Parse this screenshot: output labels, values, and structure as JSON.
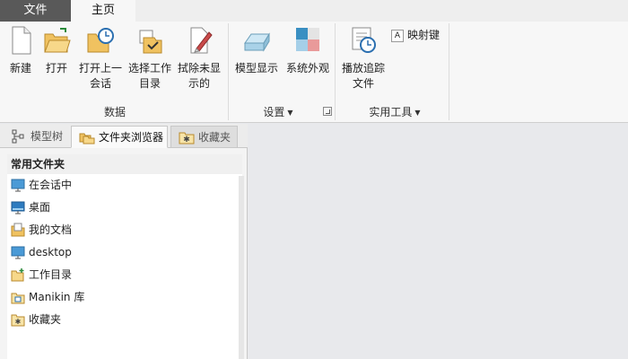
{
  "tabs": {
    "file": "文件",
    "home": "主页"
  },
  "ribbon": {
    "buttons": {
      "new": "新建",
      "open": "打开",
      "open_last_1": "打开上一",
      "open_last_2": "会话",
      "select_dir_1": "选择工作",
      "select_dir_2": "目录",
      "erase_1": "拭除未显",
      "erase_2": "示的",
      "model_display": "模型显示",
      "system_appearance": "系统外观",
      "play_trail_1": "播放追踪",
      "play_trail_2": "文件",
      "mapkeys": "映射键",
      "mapkeys_badge": "A"
    },
    "groups": {
      "data": "数据",
      "settings": "设置",
      "tools": "实用工具"
    }
  },
  "panel": {
    "tabs": {
      "model_tree": "模型树",
      "folder_browser": "文件夹浏览器",
      "favorites": "收藏夹"
    },
    "list_header": "常用文件夹",
    "items": [
      {
        "label": "在会话中",
        "icon": "monitor-icon"
      },
      {
        "label": "桌面",
        "icon": "desktop-icon"
      },
      {
        "label": "我的文档",
        "icon": "documents-icon"
      },
      {
        "label": "desktop",
        "icon": "monitor-icon"
      },
      {
        "label": "工作目录",
        "icon": "working-folder-icon"
      },
      {
        "label": "Manikin 库",
        "icon": "library-icon"
      },
      {
        "label": "收藏夹",
        "icon": "favorites-icon"
      }
    ]
  }
}
